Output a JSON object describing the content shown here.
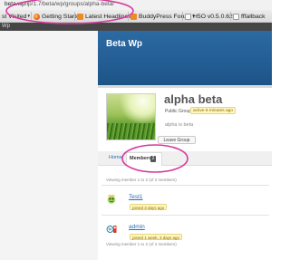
{
  "browser": {
    "url_host": "beta.wp",
    "url_path": "/ip/1.7/beta/wp/groups/alpha-beta/",
    "bookmarks": [
      {
        "label": "st Visited",
        "icon": "history-icon",
        "dropdown": true
      },
      {
        "label": "Getting Started",
        "icon": "firefox-icon",
        "dropdown": false
      },
      {
        "label": "Latest Headlines",
        "icon": "rss-icon",
        "dropdown": true
      },
      {
        "label": "BuddyPress Foru...",
        "icon": "rss-icon",
        "dropdown": true
      },
      {
        "label": "H5O v0.5.0.62",
        "icon": "bookmark-icon",
        "dropdown": false
      },
      {
        "label": "fffallback",
        "icon": "bookmark-icon",
        "dropdown": false
      }
    ],
    "admin_bar_text": "Wp"
  },
  "site": {
    "title": "Beta Wp"
  },
  "group": {
    "name": "alpha beta",
    "type": "Public Group",
    "active": "active 8 minutes ago",
    "description": "alpha is beta",
    "leave_label": "Leave Group"
  },
  "tabs": {
    "home": "Home",
    "members": "Members",
    "members_count": "2"
  },
  "members": {
    "viewing_top": "Viewing member 1 to 2 (of 2 members)",
    "viewing_bottom": "Viewing member 1 to 2 (of 2 members)",
    "list": [
      {
        "name": "Test1",
        "joined": "joined 3 days ago",
        "avatar": "wavatar-icon"
      },
      {
        "name": "admin",
        "joined": "joined 1 week, 3 days ago",
        "avatar": "wordpress-avatar-icon"
      }
    ]
  },
  "colors": {
    "banner": "#1d5488",
    "link": "#2a6db6",
    "annotation": "#d63a9c",
    "badge_bg": "#fff7c2"
  }
}
